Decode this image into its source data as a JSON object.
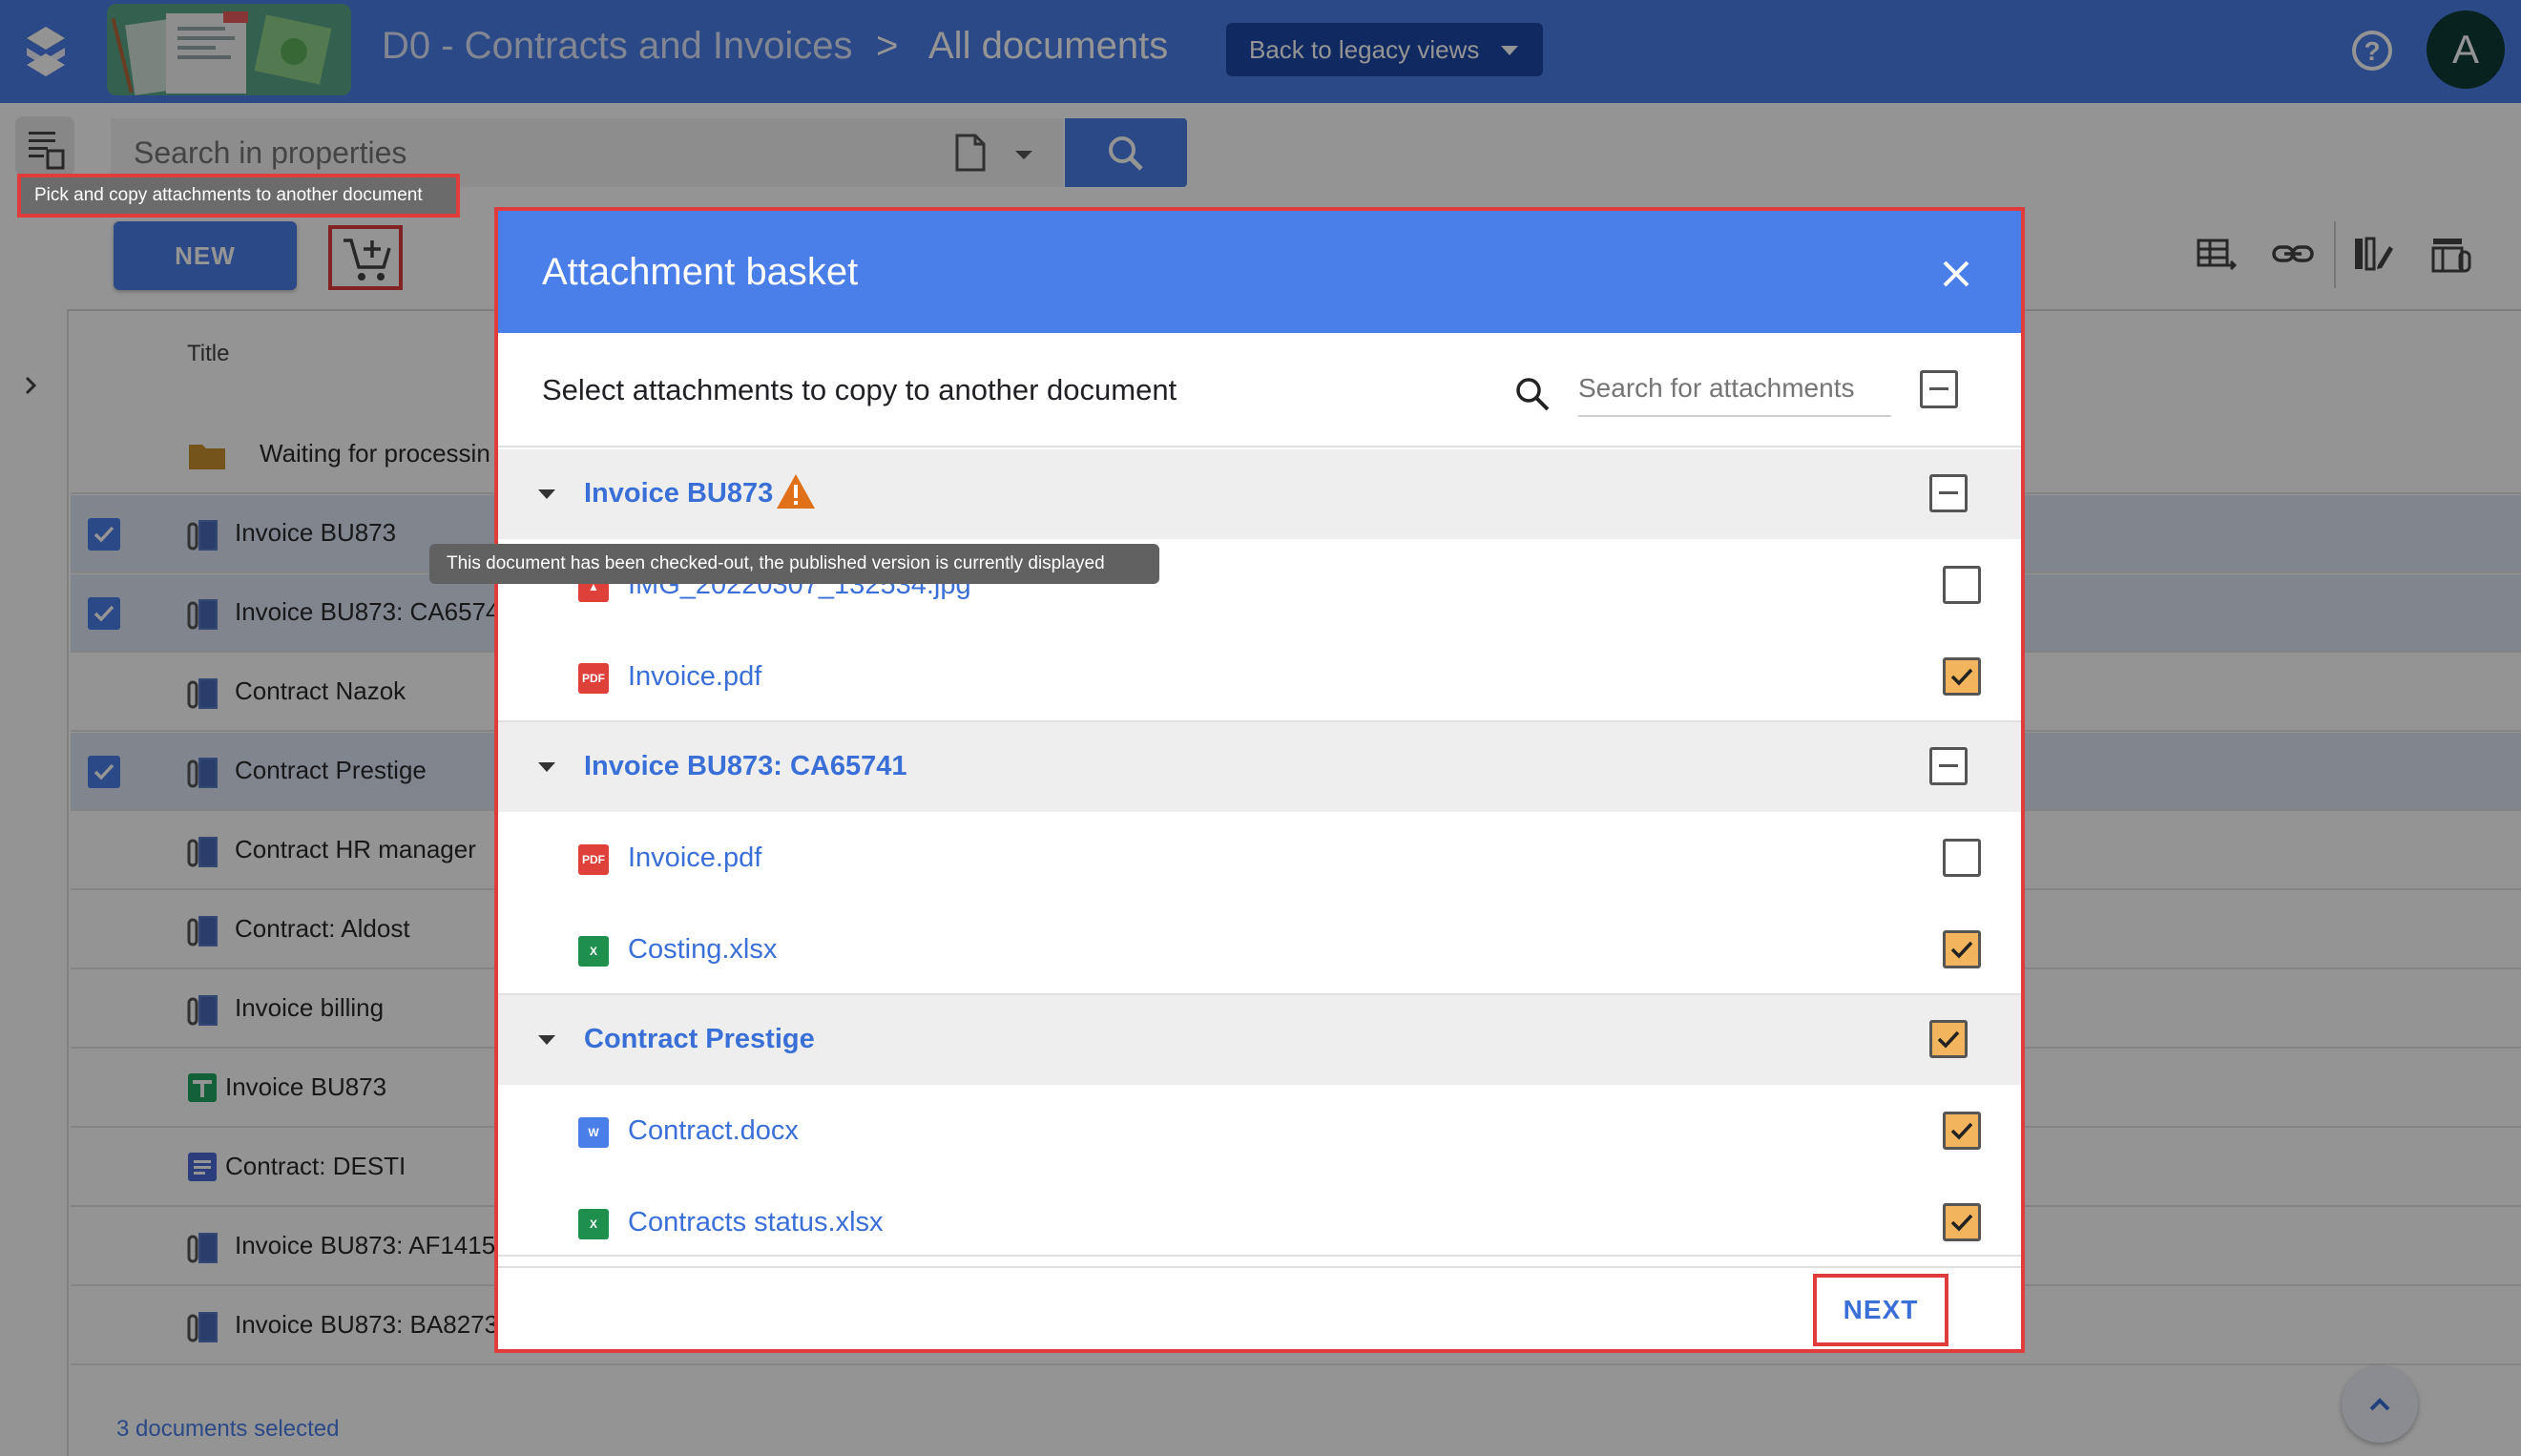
{
  "header": {
    "breadcrumb_workspace": "D0 - Contracts and Invoices",
    "breadcrumb_separator": ">",
    "breadcrumb_view": "All documents",
    "legacy_button": "Back to legacy views",
    "help_icon": "help-circle-icon",
    "avatar_initial": "A",
    "accent_color": "#4a7ee8"
  },
  "toolbar": {
    "search_placeholder": "Search in properties",
    "new_button": "NEW",
    "pick_tooltip": "Pick and copy attachments to another document"
  },
  "list": {
    "column_title": "Title",
    "rows": [
      {
        "label": "Waiting for processin",
        "icon": "folder-icon",
        "selected": false
      },
      {
        "label": "Invoice BU873",
        "icon": "attachment-doc-icon",
        "selected": true
      },
      {
        "label": "Invoice BU873: CA6574",
        "icon": "attachment-doc-icon",
        "selected": true
      },
      {
        "label": "Contract Nazok",
        "icon": "attachment-doc-icon",
        "selected": false
      },
      {
        "label": "Contract Prestige",
        "icon": "attachment-doc-icon",
        "selected": true
      },
      {
        "label": "Contract HR manager",
        "icon": "attachment-doc-icon",
        "selected": false
      },
      {
        "label": "Contract: Aldost",
        "icon": "attachment-doc-icon",
        "selected": false
      },
      {
        "label": "Invoice billing",
        "icon": "attachment-doc-icon",
        "selected": false
      },
      {
        "label": "Invoice BU873",
        "icon": "sheet-icon",
        "selected": false
      },
      {
        "label": "Contract: DESTI",
        "icon": "doc-icon",
        "selected": false
      },
      {
        "label": "Invoice BU873: AF1415",
        "icon": "attachment-doc-icon",
        "selected": false
      },
      {
        "label": "Invoice BU873: BA8273",
        "icon": "attachment-doc-icon",
        "selected": false
      }
    ],
    "status": "3 documents selected"
  },
  "dialog": {
    "title": "Attachment basket",
    "subtitle": "Select attachments to copy to another document",
    "search_placeholder": "Search for attachments",
    "checked_out_tooltip": "This document has been checked-out, the published version is currently displayed",
    "groups": [
      {
        "name": "Invoice BU873",
        "state": "partial",
        "warning": true,
        "files": [
          {
            "name": "IMG_20220307_132534.jpg",
            "type": "image",
            "checked": false
          },
          {
            "name": "Invoice.pdf",
            "type": "pdf",
            "checked": true
          }
        ]
      },
      {
        "name": "Invoice BU873: CA65741",
        "state": "partial",
        "warning": false,
        "files": [
          {
            "name": "Invoice.pdf",
            "type": "pdf",
            "checked": false
          },
          {
            "name": "Costing.xlsx",
            "type": "excel",
            "checked": true
          }
        ]
      },
      {
        "name": "Contract Prestige",
        "state": "checked",
        "warning": false,
        "files": [
          {
            "name": "Contract.docx",
            "type": "word",
            "checked": true
          },
          {
            "name": "Contracts status.xlsx",
            "type": "excel",
            "checked": true
          }
        ]
      }
    ],
    "next_button": "NEXT",
    "check_color": "#f2b45c"
  }
}
